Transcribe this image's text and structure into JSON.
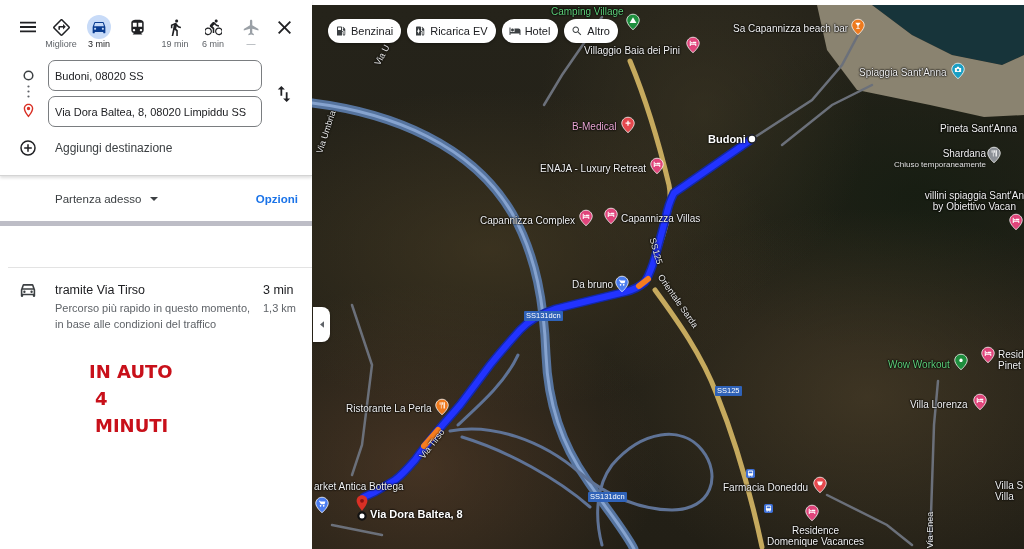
{
  "panel": {
    "travel_modes": [
      {
        "kind": "best",
        "label": "Migliore",
        "selected": false,
        "disabled": false
      },
      {
        "kind": "car",
        "label": "3 min",
        "selected": true,
        "disabled": false
      },
      {
        "kind": "transit",
        "selected": false,
        "disabled": false
      },
      {
        "kind": "walk",
        "label": "19 min",
        "selected": false,
        "disabled": false
      },
      {
        "kind": "bike",
        "label": "6 min",
        "selected": false,
        "disabled": false
      },
      {
        "kind": "flight",
        "label": "—",
        "selected": false,
        "disabled": true
      }
    ],
    "origin": {
      "value": "Budoni, 08020 SS"
    },
    "destination": {
      "value": "Via Dora Baltea, 8, 08020 Limpiddu SS"
    },
    "add_destination": "Aggiungi destinazione",
    "departure": "Partenza adesso",
    "options": "Opzioni",
    "route": {
      "title": "tramite Via Tirso",
      "duration": "3 min",
      "description": "Percorso più rapido in questo momento, in base alle condizioni del traffico",
      "distance": "1,3 km"
    },
    "annotation": [
      "IN AUTO",
      "4",
      "MINUTI"
    ]
  },
  "map": {
    "chips": [
      {
        "kind": "fuel",
        "label": "Benzinai"
      },
      {
        "kind": "ev",
        "label": "Ricarica EV"
      },
      {
        "kind": "hotel",
        "label": "Hotel"
      },
      {
        "kind": "search",
        "label": "Altro"
      }
    ],
    "places": [
      {
        "kind": "camping",
        "lines": [
          "Camping Village"
        ]
      },
      {
        "kind": "bar",
        "lines": [
          "Sa Capannizza beach bar"
        ]
      },
      {
        "kind": "hotel",
        "lines": [
          "Villaggio Baia dei Pini"
        ]
      },
      {
        "kind": "photo",
        "lines": [
          "Spiaggia Sant'Anna"
        ]
      },
      {
        "kind": "medical",
        "lines": [
          "B-Medical"
        ]
      },
      {
        "kind": "area",
        "lines": [
          "Pineta Sant'Anna"
        ]
      },
      {
        "kind": "closed_restaurant",
        "lines": [
          "Shardana"
        ],
        "note": "Chiuso temporaneamente"
      },
      {
        "kind": "hotel",
        "lines": [
          "ENAJA - Luxury Retreat"
        ]
      },
      {
        "kind": "hotel",
        "lines": [
          "villini spiaggia Sant'An",
          "by Obiettivo Vacan"
        ]
      },
      {
        "kind": "hotel",
        "lines": [
          "Capannizza Complex"
        ]
      },
      {
        "kind": "hotel",
        "lines": [
          "Capannizza Villas"
        ]
      },
      {
        "kind": "shop",
        "lines": [
          "Da bruno"
        ]
      },
      {
        "kind": "hotel",
        "lines": [
          "Resid",
          "Pinet"
        ]
      },
      {
        "kind": "fitness",
        "lines": [
          "Wow Workout"
        ]
      },
      {
        "kind": "hotel",
        "lines": [
          "Villa Lorenza"
        ]
      },
      {
        "kind": "restaurant",
        "lines": [
          "Ristorante La Perla"
        ]
      },
      {
        "kind": "shop",
        "lines": [
          "arket Antica Bottega"
        ]
      },
      {
        "kind": "pharmacy",
        "lines": [
          "Farmacia Doneddu"
        ]
      },
      {
        "kind": "area",
        "lines": [
          "Villa S",
          "Villa"
        ]
      },
      {
        "kind": "hotel",
        "lines": [
          "Residence",
          "Domenique Vacances"
        ]
      }
    ],
    "road_labels": [
      "Via U",
      "Via Umbria",
      "SS125",
      "Orientale Sarda",
      "Via Tirso",
      "Via Enea"
    ],
    "road_shields": [
      "SS131dcn",
      "SS131dcn",
      "SS125"
    ],
    "endpoints": [
      {
        "kind": "origin",
        "label": "Budoni"
      },
      {
        "kind": "destination",
        "label": "Via Dora Baltea, 8"
      }
    ]
  }
}
